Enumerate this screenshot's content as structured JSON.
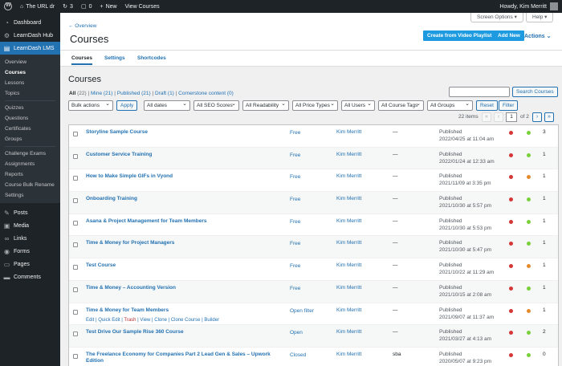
{
  "adminbar": {
    "site_name": "The URL dr",
    "updates": "3",
    "comments": "0",
    "new_label": "New",
    "view_label": "View Courses",
    "howdy": "Howdy, Kim Merritt"
  },
  "sidebar": {
    "top_items": [
      {
        "label": "Dashboard",
        "icon": "dashboard-icon"
      },
      {
        "label": "LearnDash Hub",
        "icon": "hub-icon"
      },
      {
        "label": "LearnDash LMS",
        "icon": "learndash-icon"
      }
    ],
    "sub_items": [
      "Overview",
      "Courses",
      "Lessons",
      "Topics",
      "Quizzes",
      "Questions",
      "Certificates",
      "Groups",
      "Challenge Exams",
      "Assignments",
      "Reports",
      "Course Bulk Rename",
      "Settings"
    ],
    "bottom_items": [
      {
        "label": "Posts",
        "icon": "pin-icon"
      },
      {
        "label": "Media",
        "icon": "media-icon"
      },
      {
        "label": "Links",
        "icon": "link-icon"
      },
      {
        "label": "Forms",
        "icon": "forms-icon"
      },
      {
        "label": "Pages",
        "icon": "pages-icon"
      },
      {
        "label": "Comments",
        "icon": "comment-icon"
      }
    ]
  },
  "header": {
    "overview_link": "← Overview",
    "title": "Courses",
    "create_video": "Create from Video Playlist",
    "add_new": "Add New",
    "actions": "Actions ⌄",
    "screen_options": "Screen Options ▾",
    "help": "Help ▾"
  },
  "tabs": [
    "Courses",
    "Settings",
    "Shortcodes"
  ],
  "list": {
    "heading": "Courses",
    "filters": {
      "all": "All",
      "all_count": "(22)",
      "mine": "Mine (21)",
      "published": "Published (21)",
      "draft": "Draft (1)",
      "cornerstone": "Cornerstone content (0)"
    },
    "search_button": "Search Courses",
    "bulk": "Bulk actions",
    "apply": "Apply",
    "dates": "All dates",
    "seo": "All SEO Scores",
    "readability": "All Readability",
    "price": "All Price Types",
    "users": "All Users",
    "course_tags": "All Course Tags",
    "groups": "All Groups",
    "reset": "Reset",
    "filter": "Filter",
    "items_count": "22 items",
    "page": "1",
    "of_pages": "of 2",
    "nav": {
      "first": "«",
      "prev": "‹",
      "next": "›",
      "last": "»"
    }
  },
  "colors": {
    "red": "#d63638",
    "green": "#7ad03a",
    "orange": "#e68a2e",
    "accent": "#2271b1"
  },
  "rows": [
    {
      "title": "Storyline Sample Course",
      "price": "Free",
      "author": "Kim Merritt",
      "tag": "—",
      "status": "Published",
      "date": "2022/04/25 at 11:04 am",
      "seo": "red",
      "read": "green",
      "count": "3"
    },
    {
      "title": "Customer Service Training",
      "price": "Free",
      "author": "Kim Merritt",
      "tag": "—",
      "status": "Published",
      "date": "2022/01/24 at 12:33 am",
      "seo": "red",
      "read": "green",
      "count": "1"
    },
    {
      "title": "How to Make Simple GIFs in Vyond",
      "price": "Free",
      "author": "Kim Merritt",
      "tag": "—",
      "status": "Published",
      "date": "2021/11/09 at 3:35 pm",
      "seo": "red",
      "read": "orange",
      "count": "1"
    },
    {
      "title": "Onboarding Training",
      "price": "Free",
      "author": "Kim Merritt",
      "tag": "—",
      "status": "Published",
      "date": "2021/10/30 at 5:57 pm",
      "seo": "red",
      "read": "green",
      "count": "1"
    },
    {
      "title": "Asana & Project Management for Team Members",
      "price": "Free",
      "author": "Kim Merritt",
      "tag": "—",
      "status": "Published",
      "date": "2021/10/30 at 5:53 pm",
      "seo": "red",
      "read": "green",
      "count": "1"
    },
    {
      "title": "Time & Money for Project Managers",
      "price": "Free",
      "author": "Kim Merritt",
      "tag": "—",
      "status": "Published",
      "date": "2021/10/30 at 5:47 pm",
      "seo": "red",
      "read": "green",
      "count": "1"
    },
    {
      "title": "Test Course",
      "price": "Free",
      "author": "Kim Merritt",
      "tag": "—",
      "status": "Published",
      "date": "2021/10/22 at 11:29 am",
      "seo": "red",
      "read": "orange",
      "count": "1"
    },
    {
      "title": "Time & Money – Accounting Version",
      "price": "Free",
      "author": "Kim Merritt",
      "tag": "—",
      "status": "Published",
      "date": "2021/10/15 at 2:08 am",
      "seo": "red",
      "read": "green",
      "count": "1"
    },
    {
      "title": "Time & Money for Team Members",
      "price": "Open filter",
      "author": "Kim Merritt",
      "tag": "—",
      "status": "Published",
      "date": "2021/09/07 at 11:37 am",
      "seo": "red",
      "read": "orange",
      "count": "1",
      "actions": true
    },
    {
      "title": "Test Drive Our Sample Rise 360 Course",
      "price": "Open",
      "author": "Kim Merritt",
      "tag": "—",
      "status": "Published",
      "date": "2021/03/27 at 4:13 am",
      "seo": "red",
      "read": "green",
      "count": "2"
    },
    {
      "title": "The Freelance Economy for Companies Part 2 Lead Gen & Sales – Upwork Edition",
      "price": "Closed",
      "author": "Kim Merritt",
      "tag": "sba",
      "status": "Published",
      "date": "2020/05/07 at 9:23 pm",
      "seo": "red",
      "read": "green",
      "count": "0"
    }
  ],
  "row_actions": {
    "edit": "Edit",
    "quick_edit": "Quick Edit",
    "trash": "Trash",
    "view": "View",
    "clone": "Clone",
    "clone_course": "Clone Course",
    "builder": "Builder",
    "sep": " | "
  }
}
